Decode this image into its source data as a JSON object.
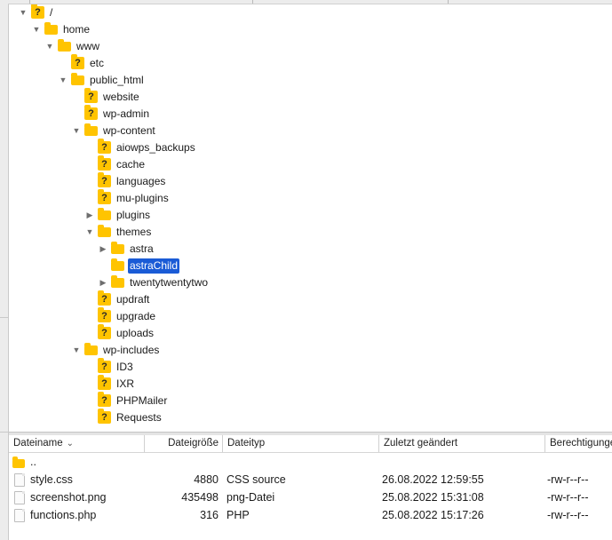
{
  "tree": {
    "items": [
      {
        "label": "/",
        "icon": "unknown-icon",
        "arrow": "open"
      },
      {
        "label": "home",
        "icon": "folder-icon",
        "arrow": "open"
      },
      {
        "label": "www",
        "icon": "folder-icon",
        "arrow": "open"
      },
      {
        "label": "etc",
        "icon": "unknown-icon",
        "arrow": "none"
      },
      {
        "label": "public_html",
        "icon": "folder-icon",
        "arrow": "open"
      },
      {
        "label": "website",
        "icon": "unknown-icon",
        "arrow": "none"
      },
      {
        "label": "wp-admin",
        "icon": "unknown-icon",
        "arrow": "none"
      },
      {
        "label": "wp-content",
        "icon": "folder-icon",
        "arrow": "open"
      },
      {
        "label": "aiowps_backups",
        "icon": "unknown-icon",
        "arrow": "none"
      },
      {
        "label": "cache",
        "icon": "unknown-icon",
        "arrow": "none"
      },
      {
        "label": "languages",
        "icon": "unknown-icon",
        "arrow": "none"
      },
      {
        "label": "mu-plugins",
        "icon": "unknown-icon",
        "arrow": "none"
      },
      {
        "label": "plugins",
        "icon": "folder-icon",
        "arrow": "closed"
      },
      {
        "label": "themes",
        "icon": "folder-icon",
        "arrow": "open"
      },
      {
        "label": "astra",
        "icon": "folder-icon",
        "arrow": "closed"
      },
      {
        "label": "astraChild",
        "icon": "folder-icon",
        "arrow": "none",
        "selected": true
      },
      {
        "label": "twentytwentytwo",
        "icon": "folder-icon",
        "arrow": "closed"
      },
      {
        "label": "updraft",
        "icon": "unknown-icon",
        "arrow": "none"
      },
      {
        "label": "upgrade",
        "icon": "unknown-icon",
        "arrow": "none"
      },
      {
        "label": "uploads",
        "icon": "unknown-icon",
        "arrow": "none"
      },
      {
        "label": "wp-includes",
        "icon": "folder-icon",
        "arrow": "open"
      },
      {
        "label": "ID3",
        "icon": "unknown-icon",
        "arrow": "none"
      },
      {
        "label": "IXR",
        "icon": "unknown-icon",
        "arrow": "none"
      },
      {
        "label": "PHPMailer",
        "icon": "unknown-icon",
        "arrow": "none"
      },
      {
        "label": "Requests",
        "icon": "unknown-icon",
        "arrow": "none"
      }
    ]
  },
  "filelist": {
    "columns": {
      "name": "Dateiname",
      "size": "Dateigröße",
      "type": "Dateityp",
      "modified": "Zuletzt geändert",
      "perms": "Berechtigungen"
    },
    "parent_label": "..",
    "rows": [
      {
        "name": "style.css",
        "size": "4880",
        "type": "CSS source",
        "modified": "26.08.2022 12:59:55",
        "perms": "-rw-r--r--"
      },
      {
        "name": "screenshot.png",
        "size": "435498",
        "type": "png-Datei",
        "modified": "25.08.2022 15:31:08",
        "perms": "-rw-r--r--"
      },
      {
        "name": "functions.php",
        "size": "316",
        "type": "PHP",
        "modified": "25.08.2022 15:17:26",
        "perms": "-rw-r--r--"
      }
    ]
  },
  "colors": {
    "selection": "#1a5bd6",
    "folder": "#ffc400"
  }
}
